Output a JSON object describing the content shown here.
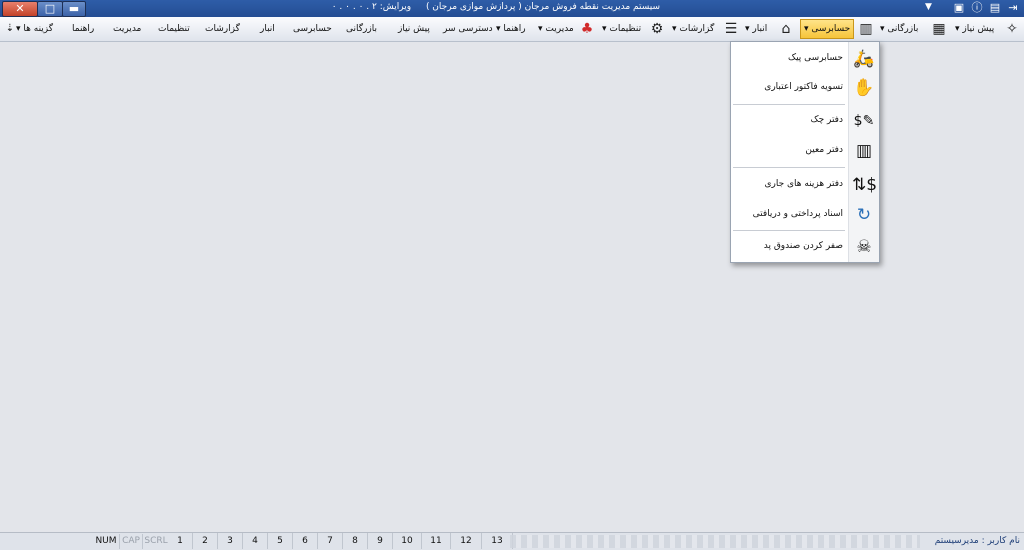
{
  "titlebar": {
    "app_title": "سیستم مدیریت نقطه فروش مرجان ( پردازش موازی مرجان )",
    "version": "ویرایش: ۲ . ۰ . ۰ . ۰",
    "close_glyph": "✕",
    "max_glyph": "□",
    "min_glyph": "▬"
  },
  "ribbon": {
    "group_labels": {
      "bazargani": "بازرگانی",
      "payannaar": "پیش نیاز",
      "hesabresi": "حسابرسی",
      "anbar": "انبار",
      "gozareshat": "گزارشات",
      "tanzimat": "تنظیمات",
      "modiriat": "مدیریت",
      "rahnama": "راهنما",
      "dastresi": "دسترسی سر",
      "gozineha": "گزینه ها"
    },
    "tabs": [
      "پیش نیاز",
      "بازرگانی",
      "حسابرسی",
      "انبار",
      "گزارشات",
      "تنظیمات",
      "مدیریت",
      "راهنما"
    ]
  },
  "menu": {
    "items": [
      {
        "label": "حسابرسی پیک",
        "icon": "courier-icon"
      },
      {
        "label": "تسویه فاکتور اعتباری",
        "icon": "hand-card-icon"
      },
      {
        "label": "دفتر چک",
        "icon": "checkbook-icon"
      },
      {
        "label": "دفتر معین",
        "icon": "ledger-books-icon"
      },
      {
        "label": "دفتر هزینه های جاری",
        "icon": "expense-arrows-icon"
      },
      {
        "label": "اسناد پرداختی و دریافتی",
        "icon": "refresh-chart-icon"
      },
      {
        "label": "صفر کردن صندوق پد",
        "icon": "skull-reset-icon"
      }
    ]
  },
  "statusbar": {
    "num": "NUM",
    "cap": "CAP",
    "scrl": "SCRL",
    "pages": [
      "1",
      "2",
      "3",
      "4",
      "5",
      "6",
      "7",
      "8",
      "9",
      "10",
      "11",
      "12",
      "13"
    ],
    "user": "نام کاربر : مدیرسیستم"
  }
}
